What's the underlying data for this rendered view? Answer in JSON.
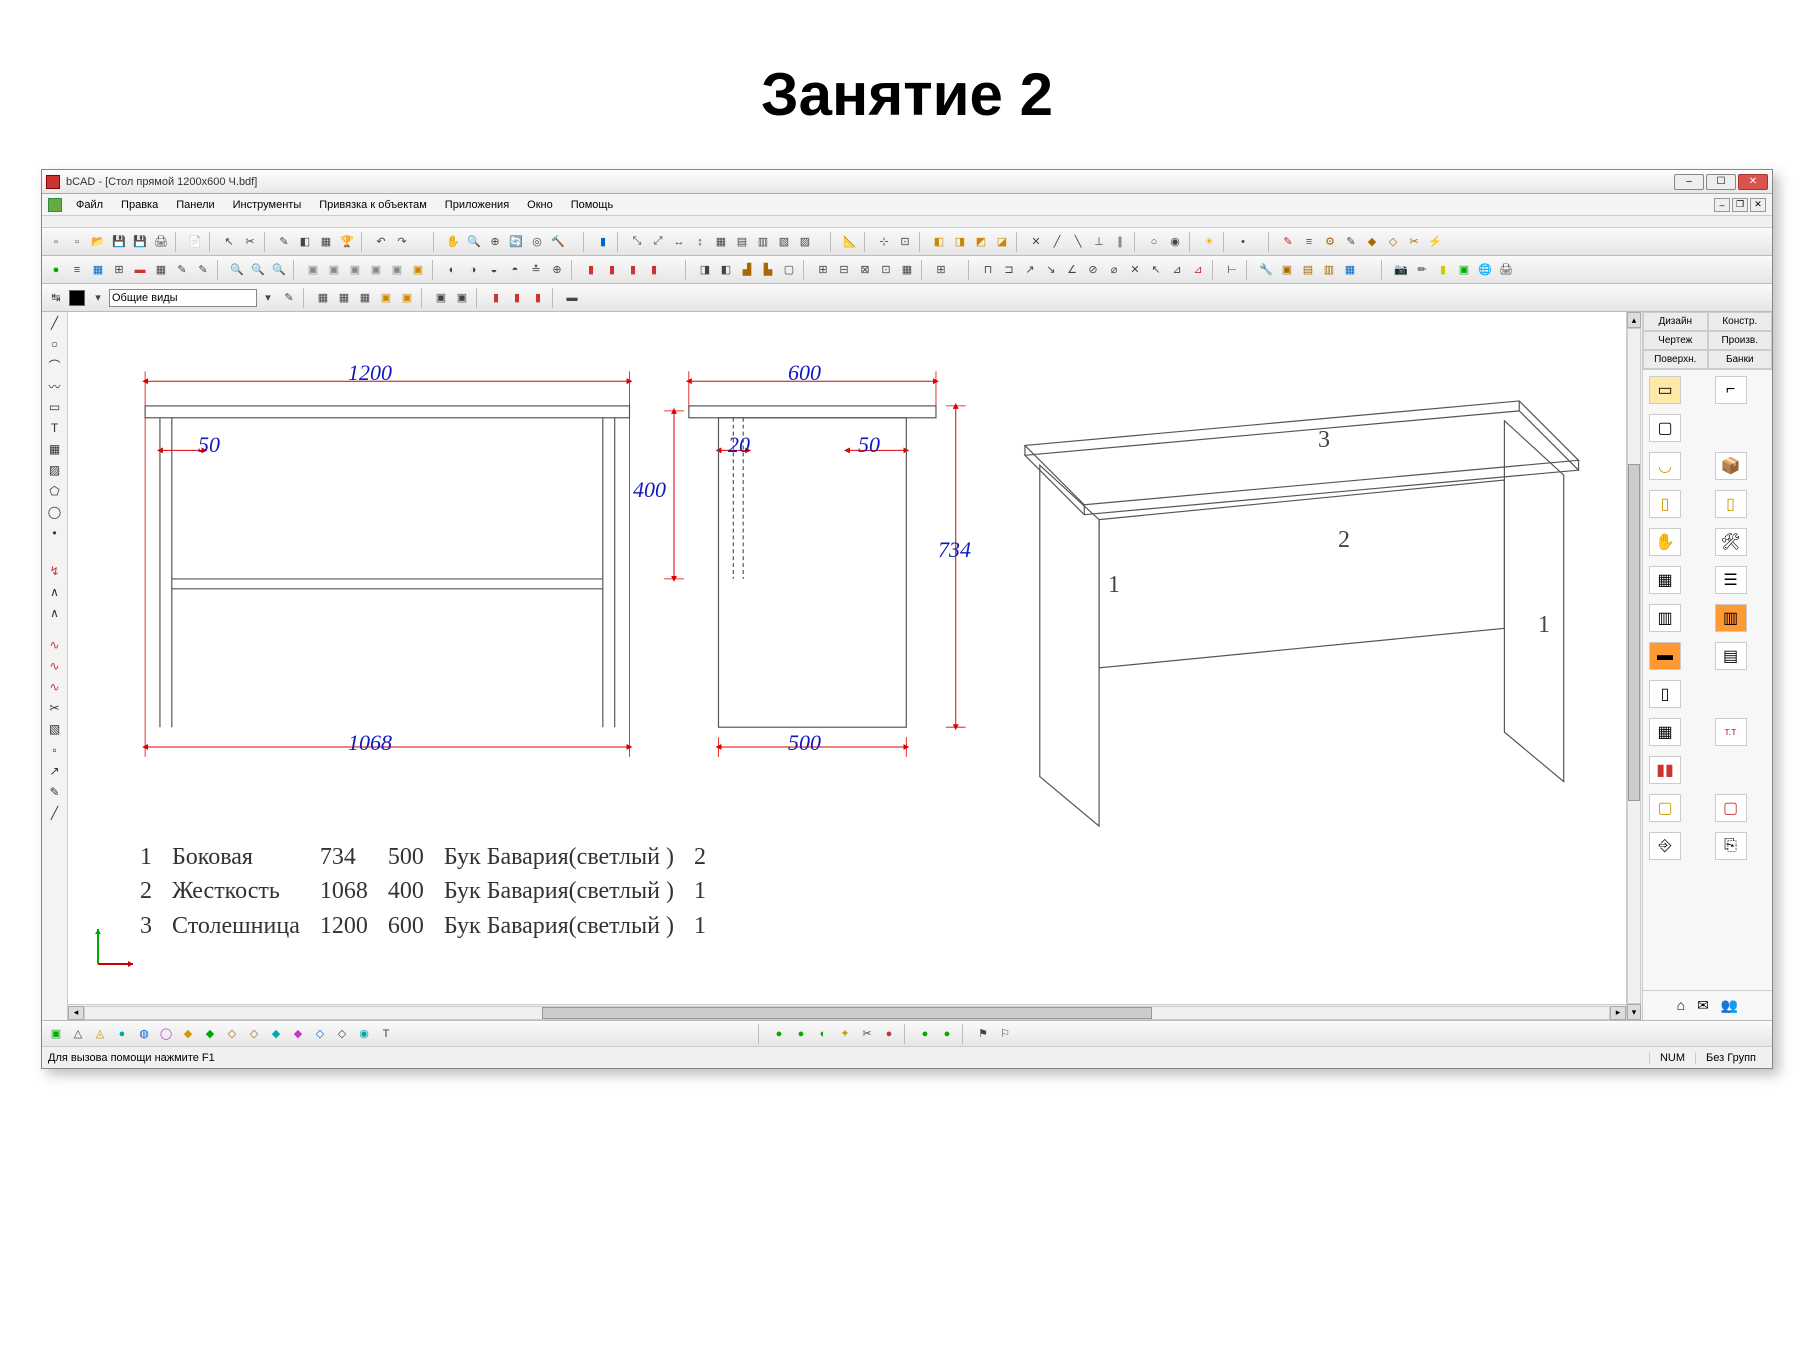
{
  "slide": {
    "title": "Занятие 2"
  },
  "window": {
    "title": "bCAD - [Стол прямой 1200x600 Ч.bdf]",
    "buttons": {
      "min": "–",
      "max": "☐",
      "close": "✕"
    }
  },
  "menu": {
    "file": "Файл",
    "edit": "Правка",
    "panels": "Панели",
    "tools": "Инструменты",
    "snap": "Привязка к объектам",
    "apps": "Приложения",
    "window": "Окно",
    "help": "Помощь"
  },
  "props_toolbar": {
    "layer_combo": "Общие виды"
  },
  "right_panel": {
    "tabs": {
      "design": "Дизайн",
      "constr": "Констр.",
      "draw": "Чертеж",
      "prod": "Произв.",
      "surf": "Поверхн.",
      "banks": "Банки"
    }
  },
  "drawing": {
    "dims": {
      "d1200": "1200",
      "d600": "600",
      "d50a": "50",
      "d20": "20",
      "d50b": "50",
      "d400": "400",
      "d734": "734",
      "d1068": "1068",
      "d500": "500"
    },
    "labels": {
      "p1": "1",
      "p2": "2",
      "p3": "3",
      "iso1a": "1",
      "iso1b": "1",
      "iso2": "2",
      "iso3": "3"
    },
    "spec": {
      "rows": [
        {
          "n": "1",
          "name": "Боковая",
          "a": "734",
          "b": "500",
          "mat": "Бук Бавария(светлый )",
          "qty": "2"
        },
        {
          "n": "2",
          "name": "Жесткость",
          "a": "1068",
          "b": "400",
          "mat": "Бук Бавария(светлый )",
          "qty": "1"
        },
        {
          "n": "3",
          "name": "Столешница",
          "a": "1200",
          "b": "600",
          "mat": "Бук Бавария(светлый )",
          "qty": "1"
        }
      ]
    }
  },
  "status": {
    "msg": "Для вызова помощи нажмите F1",
    "num": "NUM",
    "group": "Без Групп"
  }
}
